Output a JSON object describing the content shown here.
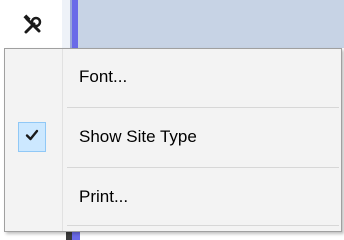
{
  "toolbar": {
    "tools_icon": "tools-icon",
    "header_color": "#c7d3e5",
    "accent_color": "#6a6ae8"
  },
  "menu": {
    "items": [
      {
        "label": "Font...",
        "checked": false
      },
      {
        "label": "Show Site Type",
        "checked": true,
        "check_icon": "checkmark-icon"
      },
      {
        "label": "Print...",
        "checked": false
      }
    ],
    "check_highlight_color": "#cce8ff"
  }
}
